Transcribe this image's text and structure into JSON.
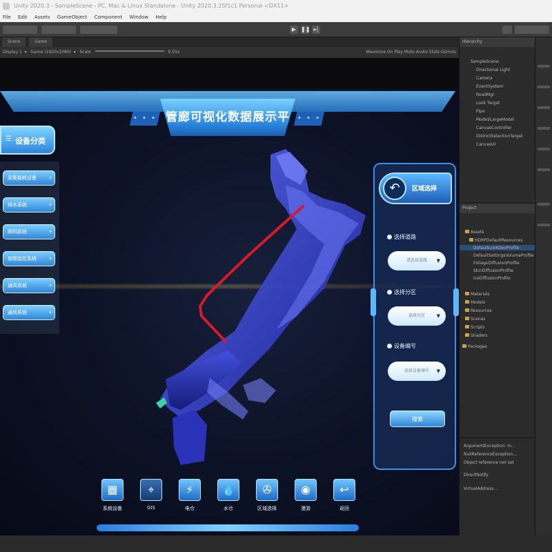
{
  "window": {
    "title": "Unity 2020.3 - SampleScene - PC, Mac & Linux Standalone - Unity 2020.3.25f1c1 Personal <DX11>",
    "menu": [
      "File",
      "Edit",
      "Assets",
      "GameObject",
      "Component",
      "Window",
      "Help"
    ]
  },
  "game_view": {
    "tabs": [
      "Scene",
      "Game"
    ],
    "display": "Display 1",
    "resolution": "Game (1920x1080)",
    "scale_label": "Scale",
    "scale_value": "0.55x",
    "options": "Maximize On Play   Mute Audio   Stats   Gizmos"
  },
  "app": {
    "title": "管廊可视化数据展示平台",
    "title_dots": "• • •",
    "left_panel": {
      "header": "设备分类",
      "items": [
        "采集能耗设备",
        "排水系统",
        "照明系统",
        "视频监控系统",
        "通风系统",
        "通风系统"
      ]
    },
    "right_panel": {
      "title": "区域选择",
      "back_icon": "back-arrow-icon",
      "fields": [
        {
          "label": "选择道路",
          "value": "请选择道路"
        },
        {
          "label": "选择分区",
          "value": "选择分区"
        },
        {
          "label": "设备编号",
          "value": "选择设备编号"
        }
      ],
      "confirm_button": "搜索"
    },
    "bottom_bar": [
      {
        "label": "系统设备",
        "icon": "grid-icon"
      },
      {
        "label": "GIS",
        "icon": "location-icon"
      },
      {
        "label": "电仓",
        "icon": "lightning-icon"
      },
      {
        "label": "水仓",
        "icon": "water-drop-icon"
      },
      {
        "label": "区域选择",
        "icon": "film-reel-icon"
      },
      {
        "label": "漫游",
        "icon": "roam-icon"
      },
      {
        "label": "返回",
        "icon": "return-icon"
      }
    ]
  },
  "hierarchy": {
    "tab": "Hierarchy",
    "items": [
      "SampleScene",
      "Directional Light",
      "Camera",
      "EventSystem",
      "RoadMgr",
      "Look Target",
      "Pipe",
      "Model/LargeModel",
      "CanvasController",
      "DistrictSelectionTarget",
      "CanvasUI"
    ]
  },
  "project": {
    "tab": "Project",
    "items": [
      "Assets",
      "HDRPDefaultResources",
      "DefaultLookDevProfile",
      "DefaultSettingsVolumeProfile",
      "FoliageDiffusionProfile",
      "SkinDiffusionProfile",
      "IceDiffusionProfile",
      "Materials",
      "Models",
      "Resources",
      "Scenes",
      "Scripts",
      "Shaders",
      "Packages"
    ],
    "console_items": [
      "ArgumentException: m...",
      "NullReferenceException...",
      "Object reference not set",
      "DirectNotify",
      "VirtualAddress..."
    ]
  },
  "colors": {
    "accent": "#2b7fd6",
    "pipe_red": "#d61a2a",
    "model_blue": "#3340c8"
  }
}
